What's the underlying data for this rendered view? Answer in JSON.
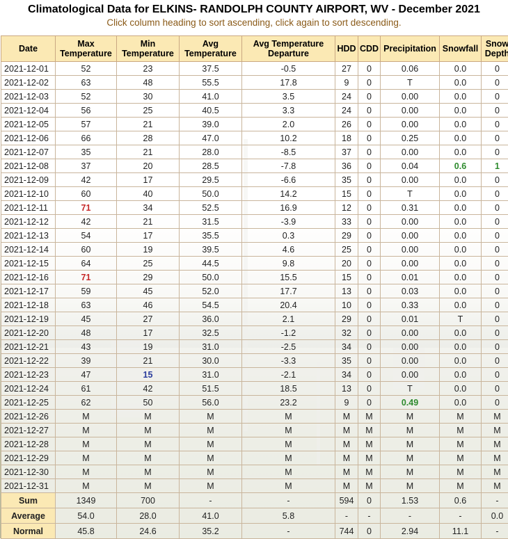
{
  "header": {
    "title": "Climatological Data for ELKINS- RANDOLPH COUNTY AIRPORT, WV - December 2021",
    "subtitle": "Click column heading to sort ascending, click again to sort descending."
  },
  "table": {
    "columns": [
      [
        "Date"
      ],
      [
        "Max",
        "Temperature"
      ],
      [
        "Min",
        "Temperature"
      ],
      [
        "Avg",
        "Temperature"
      ],
      [
        "Avg Temperature",
        "Departure"
      ],
      [
        "HDD"
      ],
      [
        "CDD"
      ],
      [
        "Precipitation"
      ],
      [
        "Snowfall"
      ],
      [
        "Snow",
        "Depth"
      ]
    ],
    "rows": [
      [
        "2021-12-01",
        "52",
        "23",
        "37.5",
        "-0.5",
        "27",
        "0",
        "0.06",
        "0.0",
        "0"
      ],
      [
        "2021-12-02",
        "63",
        "48",
        "55.5",
        "17.8",
        "9",
        "0",
        "T",
        "0.0",
        "0"
      ],
      [
        "2021-12-03",
        "52",
        "30",
        "41.0",
        "3.5",
        "24",
        "0",
        "0.00",
        "0.0",
        "0"
      ],
      [
        "2021-12-04",
        "56",
        "25",
        "40.5",
        "3.3",
        "24",
        "0",
        "0.00",
        "0.0",
        "0"
      ],
      [
        "2021-12-05",
        "57",
        "21",
        "39.0",
        "2.0",
        "26",
        "0",
        "0.00",
        "0.0",
        "0"
      ],
      [
        "2021-12-06",
        "66",
        "28",
        "47.0",
        "10.2",
        "18",
        "0",
        "0.25",
        "0.0",
        "0"
      ],
      [
        "2021-12-07",
        "35",
        "21",
        "28.0",
        "-8.5",
        "37",
        "0",
        "0.00",
        "0.0",
        "0"
      ],
      [
        "2021-12-08",
        "37",
        "20",
        "28.5",
        "-7.8",
        "36",
        "0",
        "0.04",
        "0.6",
        "1"
      ],
      [
        "2021-12-09",
        "42",
        "17",
        "29.5",
        "-6.6",
        "35",
        "0",
        "0.00",
        "0.0",
        "0"
      ],
      [
        "2021-12-10",
        "60",
        "40",
        "50.0",
        "14.2",
        "15",
        "0",
        "T",
        "0.0",
        "0"
      ],
      [
        "2021-12-11",
        "71",
        "34",
        "52.5",
        "16.9",
        "12",
        "0",
        "0.31",
        "0.0",
        "0"
      ],
      [
        "2021-12-12",
        "42",
        "21",
        "31.5",
        "-3.9",
        "33",
        "0",
        "0.00",
        "0.0",
        "0"
      ],
      [
        "2021-12-13",
        "54",
        "17",
        "35.5",
        "0.3",
        "29",
        "0",
        "0.00",
        "0.0",
        "0"
      ],
      [
        "2021-12-14",
        "60",
        "19",
        "39.5",
        "4.6",
        "25",
        "0",
        "0.00",
        "0.0",
        "0"
      ],
      [
        "2021-12-15",
        "64",
        "25",
        "44.5",
        "9.8",
        "20",
        "0",
        "0.00",
        "0.0",
        "0"
      ],
      [
        "2021-12-16",
        "71",
        "29",
        "50.0",
        "15.5",
        "15",
        "0",
        "0.01",
        "0.0",
        "0"
      ],
      [
        "2021-12-17",
        "59",
        "45",
        "52.0",
        "17.7",
        "13",
        "0",
        "0.03",
        "0.0",
        "0"
      ],
      [
        "2021-12-18",
        "63",
        "46",
        "54.5",
        "20.4",
        "10",
        "0",
        "0.33",
        "0.0",
        "0"
      ],
      [
        "2021-12-19",
        "45",
        "27",
        "36.0",
        "2.1",
        "29",
        "0",
        "0.01",
        "T",
        "0"
      ],
      [
        "2021-12-20",
        "48",
        "17",
        "32.5",
        "-1.2",
        "32",
        "0",
        "0.00",
        "0.0",
        "0"
      ],
      [
        "2021-12-21",
        "43",
        "19",
        "31.0",
        "-2.5",
        "34",
        "0",
        "0.00",
        "0.0",
        "0"
      ],
      [
        "2021-12-22",
        "39",
        "21",
        "30.0",
        "-3.3",
        "35",
        "0",
        "0.00",
        "0.0",
        "0"
      ],
      [
        "2021-12-23",
        "47",
        "15",
        "31.0",
        "-2.1",
        "34",
        "0",
        "0.00",
        "0.0",
        "0"
      ],
      [
        "2021-12-24",
        "61",
        "42",
        "51.5",
        "18.5",
        "13",
        "0",
        "T",
        "0.0",
        "0"
      ],
      [
        "2021-12-25",
        "62",
        "50",
        "56.0",
        "23.2",
        "9",
        "0",
        "0.49",
        "0.0",
        "0"
      ],
      [
        "2021-12-26",
        "M",
        "M",
        "M",
        "M",
        "M",
        "M",
        "M",
        "M",
        "M"
      ],
      [
        "2021-12-27",
        "M",
        "M",
        "M",
        "M",
        "M",
        "M",
        "M",
        "M",
        "M"
      ],
      [
        "2021-12-28",
        "M",
        "M",
        "M",
        "M",
        "M",
        "M",
        "M",
        "M",
        "M"
      ],
      [
        "2021-12-29",
        "M",
        "M",
        "M",
        "M",
        "M",
        "M",
        "M",
        "M",
        "M"
      ],
      [
        "2021-12-30",
        "M",
        "M",
        "M",
        "M",
        "M",
        "M",
        "M",
        "M",
        "M"
      ],
      [
        "2021-12-31",
        "M",
        "M",
        "M",
        "M",
        "M",
        "M",
        "M",
        "M",
        "M"
      ]
    ],
    "summary": [
      [
        "Sum",
        "1349",
        "700",
        "-",
        "-",
        "594",
        "0",
        "1.53",
        "0.6",
        "-"
      ],
      [
        "Average",
        "54.0",
        "28.0",
        "41.0",
        "5.8",
        "-",
        "-",
        "-",
        "-",
        "0.0"
      ],
      [
        "Normal",
        "45.8",
        "24.6",
        "35.2",
        "-",
        "744",
        "0",
        "2.94",
        "11.1",
        "-"
      ]
    ],
    "highlights": [
      {
        "row": 10,
        "col": 1,
        "style": "hot"
      },
      {
        "row": 15,
        "col": 1,
        "style": "hot"
      },
      {
        "row": 22,
        "col": 2,
        "style": "cold"
      },
      {
        "row": 7,
        "col": 8,
        "style": "snow"
      },
      {
        "row": 7,
        "col": 9,
        "style": "snow"
      },
      {
        "row": 24,
        "col": 7,
        "style": "snow"
      }
    ],
    "colors": {
      "header_bg": "#fbe9b4",
      "subtitle": "#8a5a18",
      "record_high": "#c62828",
      "record_low": "#2a3c9c",
      "notable": "#2e8b2e"
    }
  }
}
